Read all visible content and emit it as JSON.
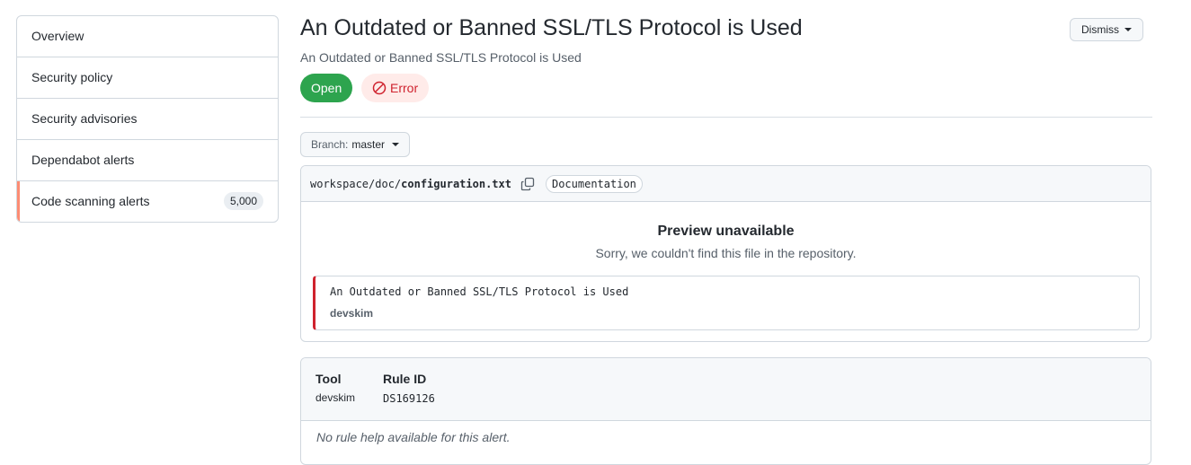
{
  "sidebar": {
    "items": [
      {
        "label": "Overview"
      },
      {
        "label": "Security policy"
      },
      {
        "label": "Security advisories"
      },
      {
        "label": "Dependabot alerts"
      },
      {
        "label": "Code scanning alerts",
        "count": "5,000",
        "selected": true
      }
    ]
  },
  "header": {
    "title": "An Outdated or Banned SSL/TLS Protocol is Used",
    "subtitle": "An Outdated or Banned SSL/TLS Protocol is Used",
    "dismiss_label": "Dismiss",
    "state_label": "Open",
    "severity_label": "Error"
  },
  "branch": {
    "prefix": "Branch:",
    "value": "master"
  },
  "file": {
    "path_dir": "workspace/doc/",
    "path_file": "configuration.txt",
    "label": "Documentation",
    "preview_title": "Preview unavailable",
    "preview_message": "Sorry, we couldn't find this file in the repository.",
    "alert_message": "An Outdated or Banned SSL/TLS Protocol is Used",
    "alert_tool": "devskim"
  },
  "rule": {
    "tool_header": "Tool",
    "tool_value": "devskim",
    "rule_id_header": "Rule ID",
    "rule_id_value": "DS169126",
    "help_text": "No rule help available for this alert."
  },
  "colors": {
    "open_green": "#2da44e",
    "error_red": "#cf222e",
    "selected_accent": "#fd8c73"
  }
}
